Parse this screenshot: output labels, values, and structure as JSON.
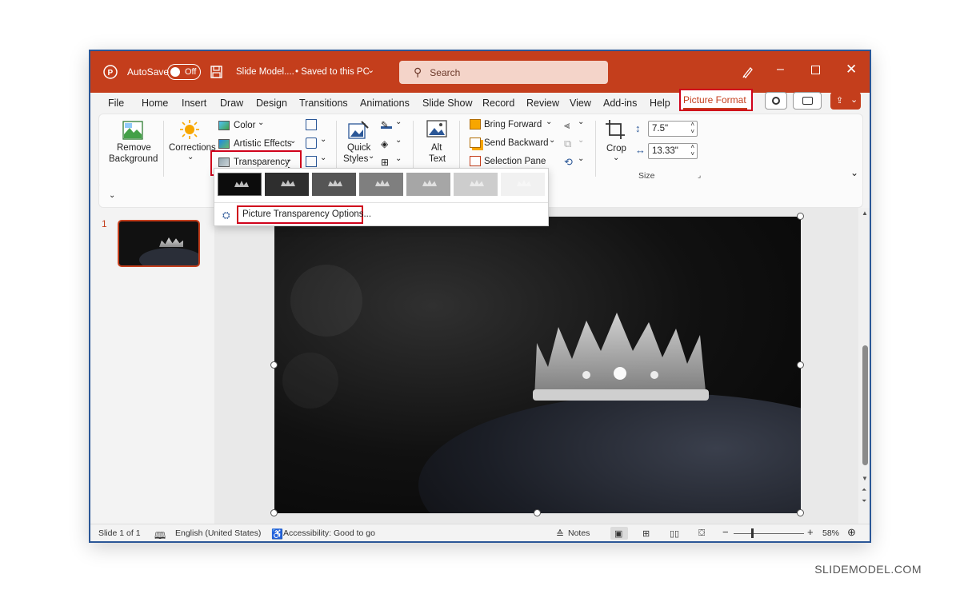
{
  "titlebar": {
    "autosave_label": "AutoSave",
    "autosave_state": "Off",
    "doc_title": "Slide Model....",
    "save_status": "• Saved to this PC",
    "search_placeholder": "Search"
  },
  "menu": {
    "tabs": [
      "File",
      "Home",
      "Insert",
      "Draw",
      "Design",
      "Transitions",
      "Animations",
      "Slide Show",
      "Record",
      "Review",
      "View",
      "Add-ins",
      "Help",
      "Picture Format"
    ],
    "active_tab": "Picture Format"
  },
  "ribbon": {
    "remove_bg": [
      "Remove",
      "Background"
    ],
    "corrections": "Corrections",
    "color": "Color",
    "artistic_effects": "Artistic Effects",
    "transparency": "Transparency",
    "quick_styles": [
      "Quick",
      "Styles"
    ],
    "alt_text": [
      "Alt",
      "Text"
    ],
    "bring_forward": "Bring Forward",
    "send_backward": "Send Backward",
    "selection_pane": "Selection Pane",
    "crop": "Crop",
    "height_value": "7.5\"",
    "width_value": "13.33\"",
    "size_group": "Size"
  },
  "transparency_menu": {
    "presets": [
      "0%",
      "15%",
      "30%",
      "50%",
      "65%",
      "80%",
      "95%"
    ],
    "options_label": "Picture Transparency Options..."
  },
  "slides": {
    "number": "1"
  },
  "status": {
    "slide_count": "Slide 1 of 1",
    "language": "English (United States)",
    "accessibility": "Accessibility: Good to go",
    "notes": "Notes",
    "zoom": "58%"
  },
  "watermark": "SLIDEMODEL.COM",
  "colors": {
    "titlebar": "#c43e1c",
    "highlight": "#d0021b",
    "window_border": "#2b5797"
  }
}
